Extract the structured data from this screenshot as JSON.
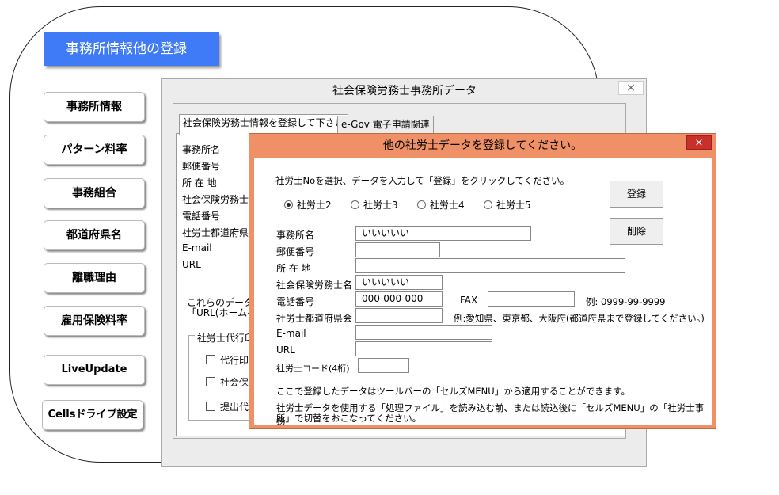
{
  "menu": {
    "title": "事務所情報他の登録",
    "buttons": [
      "事務所情報",
      "パターン料率",
      "事務組合",
      "都道府県名",
      "離職理由",
      "雇用保険料率",
      "LiveUpdate",
      "Cellsドライブ設定"
    ]
  },
  "dialog1": {
    "title": "社会保険労務士事務所データ",
    "close": "×",
    "tabs": [
      "社会保険労務士情報を登録して下さい",
      "e-Gov 電子申請関連"
    ],
    "labels": [
      "事務所名",
      "郵便番号",
      "所 在 地",
      "社会保険労務士",
      "電話番号",
      "社労士都道府県",
      "E-mail",
      "URL"
    ],
    "note_lines": [
      "これらのデータは",
      "「URL(ホームペ"
    ],
    "group_label": "社労士代行印",
    "checks": [
      "代行印の",
      "社会保",
      "提出代"
    ]
  },
  "dialog2": {
    "title": "他の社労士データを登録してください。",
    "close": "×",
    "instruction": "社労士Noを選択、データを入力して「登録」をクリックしてください。",
    "radios": [
      "社労士2",
      "社労士3",
      "社労士4",
      "社労士5"
    ],
    "selected_radio": "社労士2",
    "buttons": {
      "register": "登録",
      "delete": "削除"
    },
    "fields": {
      "office_name": {
        "label": "事務所名",
        "value": "いいいいい"
      },
      "postal": {
        "label": "郵便番号",
        "value": ""
      },
      "address": {
        "label": "所 在 地",
        "value": ""
      },
      "sharoshi_name": {
        "label": "社会保険労務士名",
        "value": "いいいいい"
      },
      "phone": {
        "label": "電話番号",
        "value": "000-000-000"
      },
      "fax": {
        "label": "FAX",
        "value": ""
      },
      "prefecture": {
        "label": "社労士都道府県会",
        "value": ""
      },
      "email": {
        "label": "E-mail",
        "value": ""
      },
      "url": {
        "label": "URL",
        "value": ""
      },
      "code": {
        "label": "社労士コード(4桁)",
        "value": ""
      }
    },
    "phone_example": "例: 0999-99-9999",
    "prefecture_example": "例:愛知県、東京都、大阪府(都道府県まで登録してください。)",
    "note1": "ここで登録したデータはツールバーの「セルズMENU」から適用することができます。",
    "note2_line1": "社労士データを使用する「処理ファイル」を読み込む前、または読込後に「セルズMENU」の「社労士事務",
    "note2_line2": "所」で切替をおこなってください。"
  }
}
